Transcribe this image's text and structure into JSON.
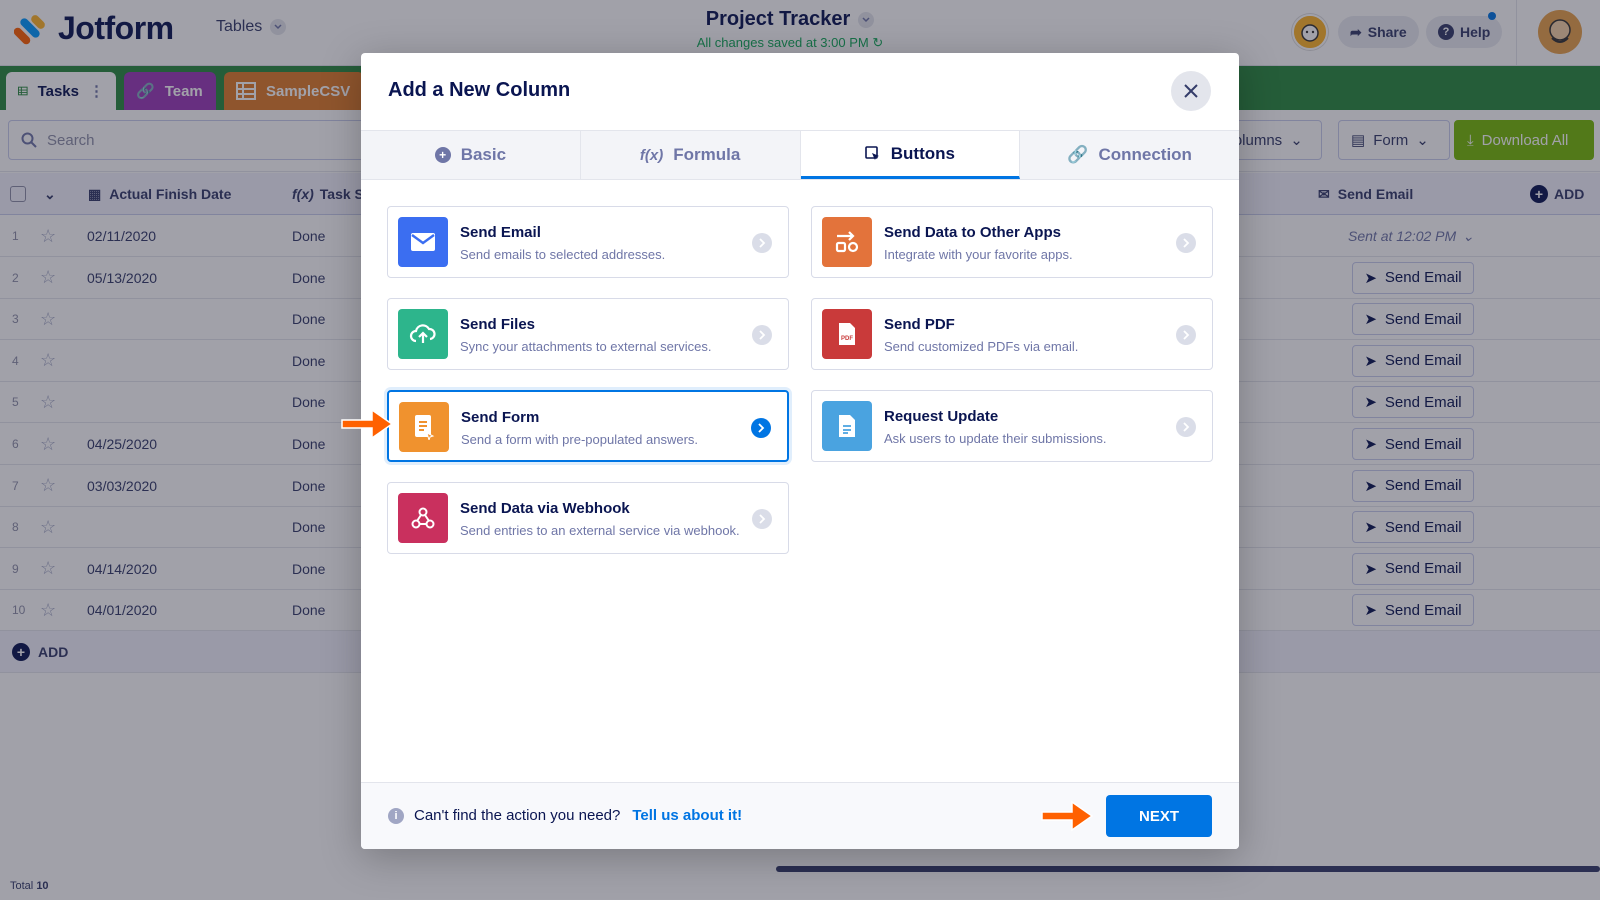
{
  "header": {
    "logo_text": "Jotform",
    "tables_label": "Tables",
    "project_title": "Project Tracker",
    "saved_status": "All changes saved at 3:00 PM",
    "share_label": "Share",
    "help_label": "Help"
  },
  "tabs": [
    {
      "label": "Tasks",
      "color": "#ffffff",
      "text": "#0a1551"
    },
    {
      "label": "Team",
      "color": "#9c3bb8",
      "text": "#ffffff"
    },
    {
      "label": "SampleCSV",
      "color": "#e07d2a",
      "text": "#ffffff"
    }
  ],
  "toolbar": {
    "search_placeholder": "Search",
    "columns_label": "Columns",
    "form_label": "Form",
    "download_label": "Download All"
  },
  "table": {
    "col_actual_finish": "Actual Finish Date",
    "col_task_status": "Task S",
    "col_send_email": "Send Email",
    "add_col": "ADD",
    "add_row": "ADD",
    "total_label": "Total",
    "total_value": "10",
    "sent_label": "Sent at 12:02 PM",
    "send_email_btn": "Send Email",
    "rows": [
      {
        "n": "1",
        "date": "02/11/2020",
        "status": "Done"
      },
      {
        "n": "2",
        "date": "05/13/2020",
        "status": "Done"
      },
      {
        "n": "3",
        "date": "",
        "status": "Done"
      },
      {
        "n": "4",
        "date": "",
        "status": "Done"
      },
      {
        "n": "5",
        "date": "",
        "status": "Done"
      },
      {
        "n": "6",
        "date": "04/25/2020",
        "status": "Done"
      },
      {
        "n": "7",
        "date": "03/03/2020",
        "status": "Done"
      },
      {
        "n": "8",
        "date": "",
        "status": "Done"
      },
      {
        "n": "9",
        "date": "04/14/2020",
        "status": "Done"
      },
      {
        "n": "10",
        "date": "04/01/2020",
        "status": "Done"
      }
    ]
  },
  "modal": {
    "title": "Add a New Column",
    "tabs": [
      "Basic",
      "Formula",
      "Buttons",
      "Connection"
    ],
    "active_tab": "Buttons",
    "cards": [
      {
        "title": "Send Email",
        "desc": "Send emails to selected addresses.",
        "color": "#3b6ef1",
        "icon": "envelope-icon"
      },
      {
        "title": "Send Data to Other Apps",
        "desc": "Integrate with your favorite apps.",
        "color": "#e3733b",
        "icon": "apps-icon"
      },
      {
        "title": "Send Files",
        "desc": "Sync your attachments to external services.",
        "color": "#2db58c",
        "icon": "cloud-upload-icon"
      },
      {
        "title": "Send PDF",
        "desc": "Send customized PDFs via email.",
        "color": "#c93a3a",
        "icon": "pdf-icon"
      },
      {
        "title": "Send Form",
        "desc": "Send a form with pre-populated answers.",
        "color": "#f0922e",
        "icon": "form-icon"
      },
      {
        "title": "Request Update",
        "desc": "Ask users to update their submissions.",
        "color": "#4aa3e0",
        "icon": "document-icon"
      },
      {
        "title": "Send Data via Webhook",
        "desc": "Send entries to an external service via webhook.",
        "color": "#c9305e",
        "icon": "webhook-icon"
      }
    ],
    "selected_card": "Send Form",
    "footer_question": "Can't find the action you need?",
    "footer_link": "Tell us about it!",
    "next_label": "NEXT"
  }
}
